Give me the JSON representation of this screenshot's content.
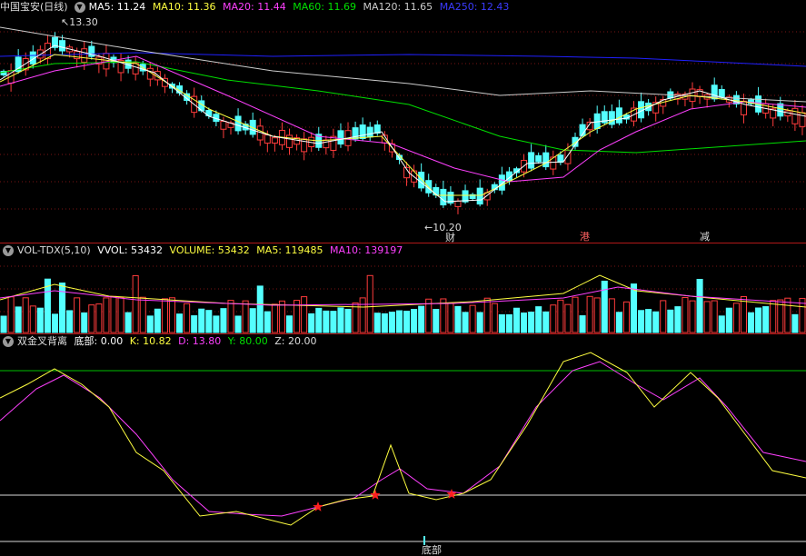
{
  "colors": {
    "up": "#ff3c3c",
    "down": "#54ffff",
    "ma5": "#ffffff",
    "ma10": "#ffff40",
    "ma20": "#ff40ff",
    "ma60": "#00e000",
    "ma120": "#cccccc",
    "ma250": "#2020ff",
    "bg": "#000000",
    "grid": "#7a1414"
  },
  "price_panel": {
    "stock": "中国宝安",
    "period": "(日线)",
    "ma5": "MA5: 11.24",
    "ma10": "MA10: 11.36",
    "ma20": "MA20: 11.44",
    "ma60": "MA60: 11.69",
    "ma120": "MA120: 11.65",
    "ma250": "MA250: 12.43",
    "high_label": "13.30",
    "low_label": "10.20",
    "markers": [
      "财",
      "港",
      "减"
    ]
  },
  "volume_panel": {
    "name": "VOL-TDX(5,10)",
    "vvol": "VVOL: 53432",
    "volume": "VOLUME: 53432",
    "ma5": "MA5: 119485",
    "ma10": "MA10: 139197"
  },
  "indicator_panel": {
    "name": "双金叉背离",
    "bottom": "底部: 0.00",
    "k": "K: 10.82",
    "d": "D: 13.80",
    "y": "Y: 80.00",
    "z": "Z: 20.00",
    "bottom_label": "底部"
  }
}
